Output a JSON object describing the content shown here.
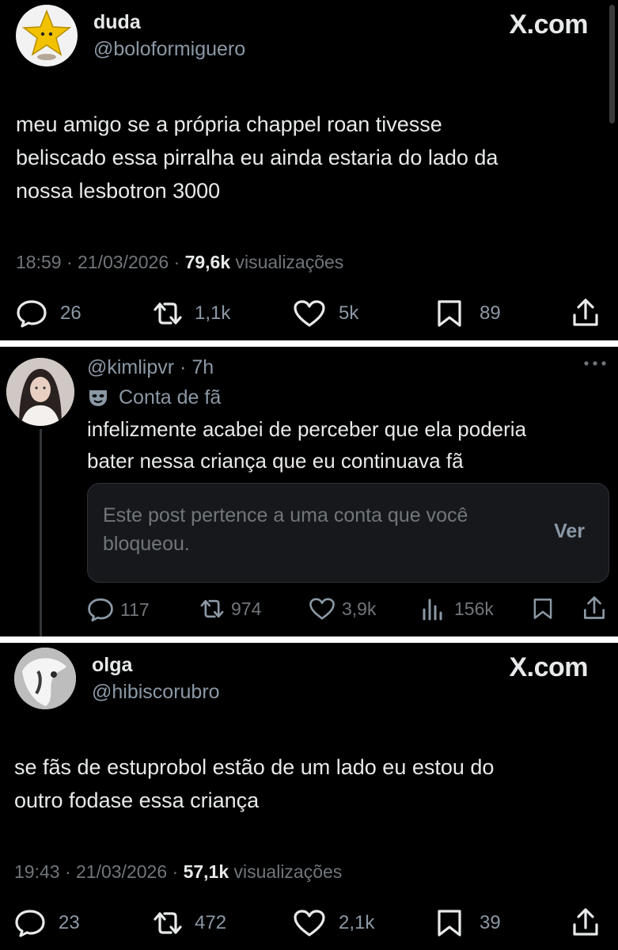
{
  "tweets": [
    {
      "name": "duda",
      "handle": "@boloformiguero",
      "site": "X.com",
      "lines": [
        "meu amigo se a própria chappel roan tivesse",
        "beliscado essa pirralha eu ainda estaria do lado da",
        "nossa lesbotron 3000"
      ],
      "time": "18:59 · 21/03/2026 · ",
      "views": "79,6k",
      "views_label": " visualizações",
      "replies": "26",
      "reposts": "1,1k",
      "likes": "5k",
      "bookmarks": "89"
    },
    {
      "handle": "@kimlipvr",
      "age": " · 7h",
      "label": "Conta de fã",
      "lines": [
        "infelizmente acabei de perceber que ela poderia",
        "bater nessa criança que eu continuava fã"
      ],
      "blocked_notice": "Este post pertence a uma conta que você bloqueou.",
      "blocked_action": "Ver",
      "replies": "117",
      "reposts": "974",
      "likes": "3,9k",
      "views": "156k"
    },
    {
      "name": "olga",
      "handle": "@hibiscorubro",
      "site": "X.com",
      "lines": [
        "se fãs de estuprobol estão de um lado eu estou do",
        "outro fodase essa criança"
      ],
      "time": "19:43 · 21/03/2026 · ",
      "views": "57,1k",
      "views_label": " visualizações",
      "replies": "23",
      "reposts": "472",
      "likes": "2,1k",
      "bookmarks": "39"
    }
  ],
  "icons": {
    "reply": "reply-icon",
    "repost": "repost-icon",
    "like": "heart-icon",
    "views": "views-chart-icon",
    "bookmark": "bookmark-icon",
    "share": "share-icon",
    "more": "more-icon",
    "mask": "mask-icon"
  },
  "colors": {
    "background": "#000000",
    "text": "#e7e9ea",
    "muted": "#71767b",
    "separator": "#ffffff"
  }
}
